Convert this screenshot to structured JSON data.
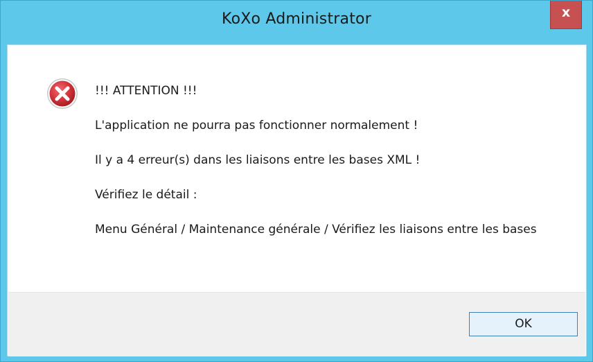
{
  "window": {
    "title": "KoXo Administrator",
    "close_glyph": "x",
    "accent_color": "#5ec8ea",
    "close_color": "#c75050"
  },
  "icon": {
    "name": "error-icon",
    "color": "#d3343c"
  },
  "message": {
    "lines": [
      "!!! ATTENTION !!!",
      "L'application ne pourra pas fonctionner normalement !",
      "Il y a 4 erreur(s) dans les liaisons entre les bases XML !",
      "Vérifiez le détail :",
      "Menu Général / Maintenance générale / Vérifiez les liaisons entre les bases"
    ]
  },
  "buttons": {
    "ok_label": "OK"
  }
}
